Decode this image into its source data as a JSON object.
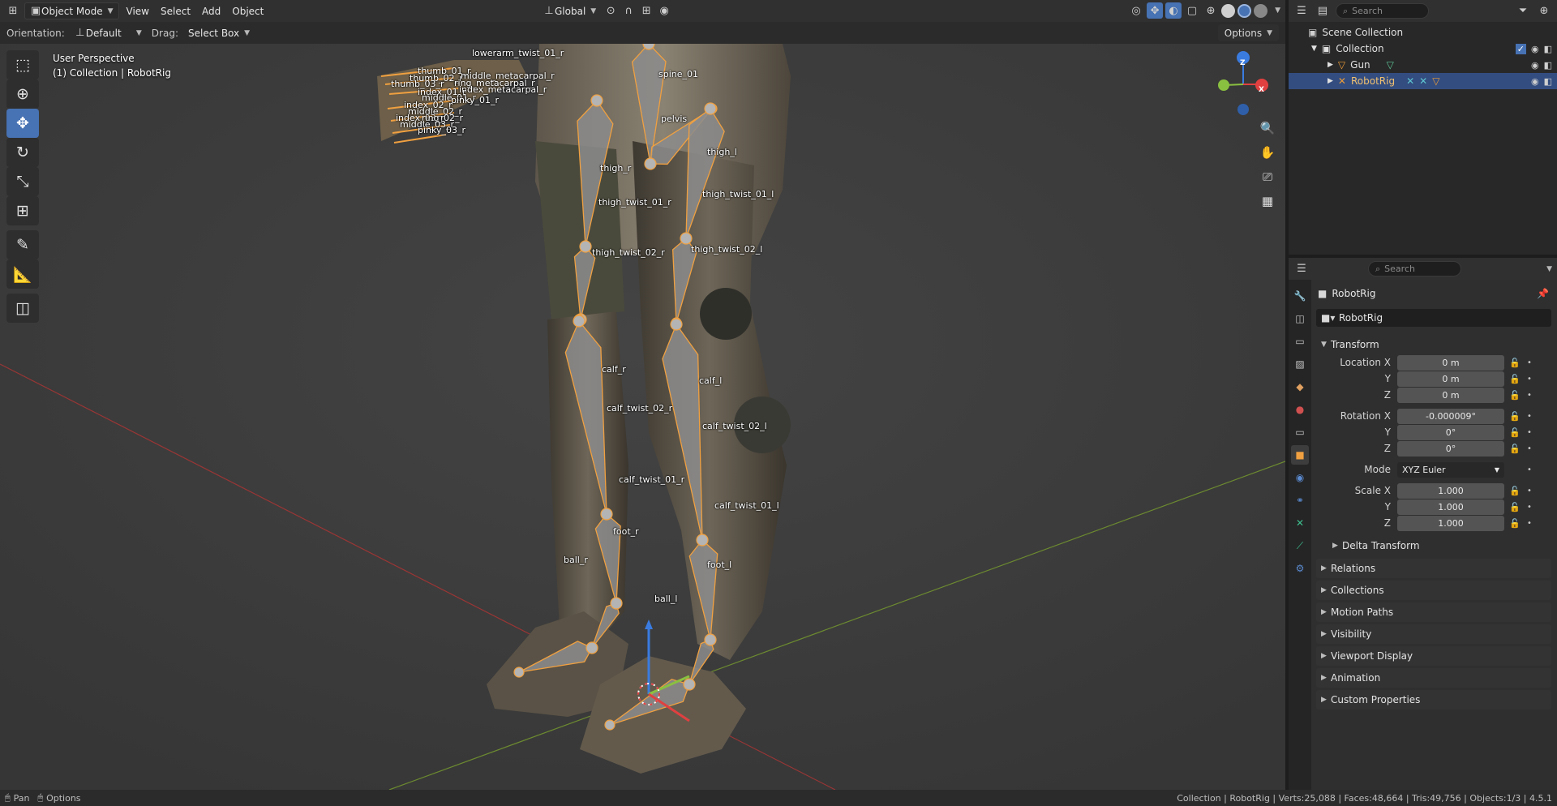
{
  "header": {
    "mode": "Object Mode",
    "menus": [
      "View",
      "Select",
      "Add",
      "Object"
    ],
    "orientation_transform": "Global"
  },
  "tool_settings": {
    "orientation_label": "Orientation:",
    "orientation_value": "Default",
    "drag_label": "Drag:",
    "drag_value": "Select Box",
    "options_label": "Options"
  },
  "viewport": {
    "perspective": "User Perspective",
    "collection_info": "(1) Collection | RobotRig",
    "bone_labels": [
      "lowerarm_twist_01_r",
      "spine_01",
      "thumb_01_r",
      "thumb_02_r",
      "thumb_03_r",
      "middle_metacarpal_r",
      "ring_metacarpal_r",
      "index_metacarpal_r",
      "index_01_r",
      "middle_01_r",
      "pinky_01_r",
      "index_02_r",
      "middle_02_r",
      "index_03_r",
      "ring_02_r",
      "middle_03_r",
      "pinky_03_r",
      "pelvis",
      "thigh_r",
      "thigh_l",
      "thigh_twist_01_r",
      "thigh_twist_01_l",
      "thigh_twist_02_r",
      "thigh_twist_02_l",
      "calf_r",
      "calf_l",
      "calf_twist_02_r",
      "calf_twist_02_l",
      "calf_twist_01_r",
      "calf_twist_01_l",
      "foot_r",
      "foot_l",
      "ball_r",
      "ball_l"
    ],
    "gizmo_axes": [
      "Z",
      "X"
    ]
  },
  "outliner": {
    "search_placeholder": "Search",
    "rows": [
      {
        "label": "Scene Collection"
      },
      {
        "label": "Collection"
      },
      {
        "label": "Gun"
      },
      {
        "label": "RobotRig"
      }
    ]
  },
  "properties": {
    "search_placeholder": "Search",
    "object_name": "RobotRig",
    "name_field": "RobotRig",
    "transform_label": "Transform",
    "location": {
      "label_x": "Location X",
      "x": "0 m",
      "y": "0 m",
      "z": "0 m"
    },
    "rotation": {
      "label_x": "Rotation X",
      "x": "-0.000009°",
      "y": "0°",
      "z": "0°"
    },
    "mode_label": "Mode",
    "mode_value": "XYZ Euler",
    "scale": {
      "label_x": "Scale X",
      "x": "1.000",
      "y": "1.000",
      "z": "1.000"
    },
    "axis_y": "Y",
    "axis_z": "Z",
    "delta_transform": "Delta Transform",
    "panels": [
      "Relations",
      "Collections",
      "Motion Paths",
      "Visibility",
      "Viewport Display",
      "Animation",
      "Custom Properties"
    ]
  },
  "statusbar": {
    "pan": "Pan",
    "options": "Options",
    "stats": "Collection | RobotRig | Verts:25,088 | Faces:48,664 | Tris:49,756 | Objects:1/3 | 4.5.1"
  },
  "colors": {
    "accent": "#4772b3",
    "bone_outline": "#f0a040",
    "selected_row": "#334d80",
    "x_axis": "#b53a3a",
    "y_axis": "#7fa63a"
  }
}
